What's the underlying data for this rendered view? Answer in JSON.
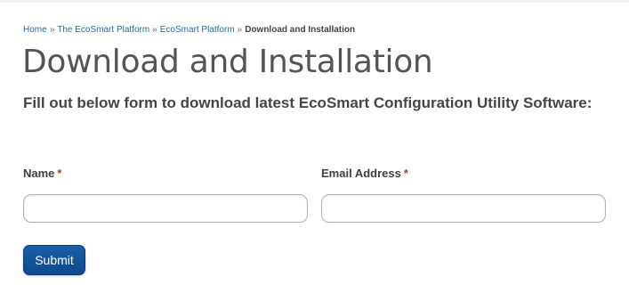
{
  "breadcrumb": {
    "items": [
      {
        "label": "Home"
      },
      {
        "label": "The EcoSmart Platform"
      },
      {
        "label": "EcoSmart Platform"
      }
    ],
    "separator": "»",
    "current": "Download and Installation"
  },
  "page": {
    "title": "Download and Installation",
    "subtitle": "Fill out below form to download latest EcoSmart Configuration Utility Software:"
  },
  "form": {
    "name": {
      "label": "Name",
      "required_marker": "*",
      "value": "",
      "placeholder": ""
    },
    "email": {
      "label": "Email Address",
      "required_marker": "*",
      "value": "",
      "placeholder": ""
    },
    "submit_label": "Submit"
  },
  "colors": {
    "link": "#2a6aa8",
    "button": "#0e4a8c",
    "required": "#c0392b"
  }
}
